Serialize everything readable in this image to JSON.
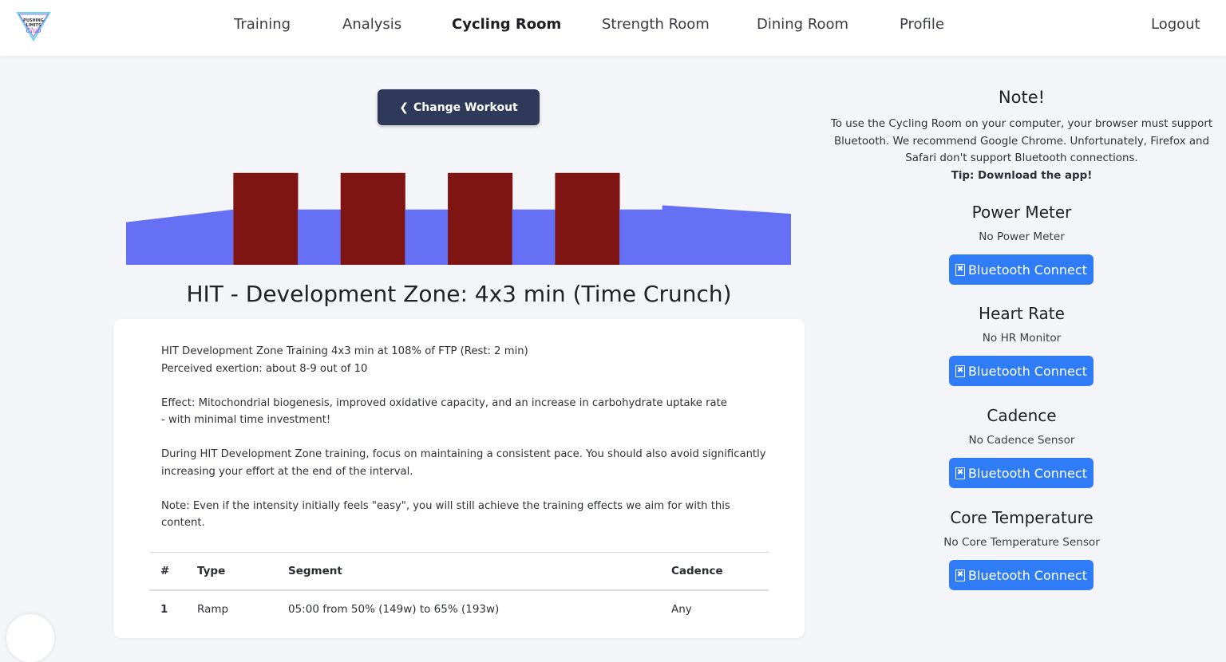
{
  "nav": {
    "logo_text": "PUSHING LIMITS Club",
    "items": [
      "Training",
      "Analysis",
      "Cycling Room",
      "Strength Room",
      "Dining Room",
      "Profile"
    ],
    "active": "Cycling Room",
    "logout": "Logout"
  },
  "workout": {
    "change_button": "Change Workout",
    "title": "HIT - Development Zone: 4x3 min (Time Crunch)",
    "description": [
      "HIT Development Zone Training 4x3 min at 108% of FTP (Rest: 2 min)",
      "Perceived exertion: about 8-9 out of 10",
      "Effect: Mitochondrial biogenesis, improved oxidative capacity, and an increase in carbohydrate uptake rate",
      "- with minimal time investment!",
      "During HIT Development Zone training, focus on maintaining a consistent pace. You should also avoid significantly",
      "increasing your effort at the end of the interval.",
      "Note: Even if the intensity initially feels \"easy\", you will still achieve the training effects we aim for with this content."
    ],
    "table": {
      "headers": [
        "#",
        "Type",
        "Segment",
        "Cadence"
      ],
      "rows": [
        [
          "1",
          "Ramp",
          "05:00 from 50% (149w) to 65% (193w)",
          "Any"
        ]
      ]
    }
  },
  "chart_data": {
    "type": "bar",
    "segments": [
      {
        "kind": "ramp",
        "from": 50,
        "to": 65,
        "minutes": 5,
        "color": "#6670f5"
      },
      {
        "kind": "interval",
        "value": 108,
        "minutes": 3,
        "color": "#7f1513"
      },
      {
        "kind": "rest",
        "value": 65,
        "minutes": 2,
        "color": "#6670f5"
      },
      {
        "kind": "interval",
        "value": 108,
        "minutes": 3,
        "color": "#7f1513"
      },
      {
        "kind": "rest",
        "value": 65,
        "minutes": 2,
        "color": "#6670f5"
      },
      {
        "kind": "interval",
        "value": 108,
        "minutes": 3,
        "color": "#7f1513"
      },
      {
        "kind": "rest",
        "value": 65,
        "minutes": 2,
        "color": "#6670f5"
      },
      {
        "kind": "interval",
        "value": 108,
        "minutes": 3,
        "color": "#7f1513"
      },
      {
        "kind": "rest",
        "value": 65,
        "minutes": 2,
        "color": "#6670f5"
      },
      {
        "kind": "ramp",
        "from": 70,
        "to": 60,
        "minutes": 6,
        "color": "#6670f5"
      }
    ]
  },
  "note": {
    "title": "Note!",
    "lines": [
      "To use the Cycling Room on your computer, your browser must support",
      "Bluetooth. We recommend Google Chrome. Unfortunately, Firefox and",
      "Safari don't support Bluetooth connections."
    ],
    "tip": "Tip: Download the app!"
  },
  "sensors": [
    {
      "title": "Power Meter",
      "status": "No Power Meter",
      "button": "Bluetooth Connect"
    },
    {
      "title": "Heart Rate",
      "status": "No HR Monitor",
      "button": "Bluetooth Connect"
    },
    {
      "title": "Cadence",
      "status": "No Cadence Sensor",
      "button": "Bluetooth Connect"
    },
    {
      "title": "Core Temperature",
      "status": "No Core Temperature Sensor",
      "button": "Bluetooth Connect"
    }
  ],
  "colors": {
    "interval": "#7f1513",
    "recovery": "#6670f5",
    "button_dark": "#2f3a5a",
    "bluetooth": "#2f7cf6"
  }
}
